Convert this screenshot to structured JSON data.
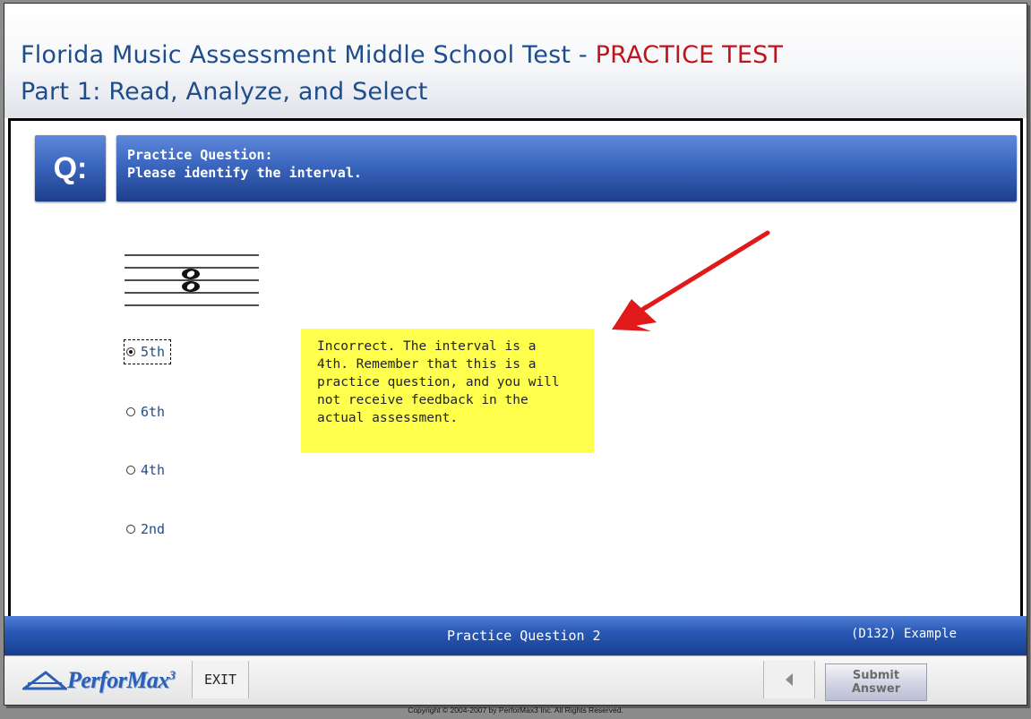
{
  "header": {
    "title_part1": "Florida Music Assessment Middle School Test - ",
    "title_highlight": "PRACTICE TEST",
    "subtitle": "Part 1: Read, Analyze, and Select"
  },
  "question": {
    "label": "Q:",
    "heading": "Practice Question:",
    "prompt": "Please identify the interval."
  },
  "options": [
    {
      "label": "5th",
      "selected": true
    },
    {
      "label": "6th",
      "selected": false
    },
    {
      "label": "4th",
      "selected": false
    },
    {
      "label": "2nd",
      "selected": false
    }
  ],
  "feedback": {
    "lines": [
      "Incorrect. The interval is a",
      "4th. Remember that this is a",
      "practice question, and you will",
      "not receive feedback in the",
      "actual assessment."
    ]
  },
  "footer": {
    "question_number": "Practice Question 2",
    "reference": "(D132) Example"
  },
  "toolbar": {
    "logo": "PerforMax",
    "logo_sup": "3",
    "exit_label": "EXIT",
    "submit_line1": "Submit",
    "submit_line2": "Answer"
  },
  "copyright": "Copyright © 2004-2007 by PerforMax3 Inc.  All Rights Reserved.",
  "colors": {
    "title_blue": "#1f4d8c",
    "title_red": "#c0141c",
    "bar_blue": "#2a59b5",
    "feedback_yellow": "#ffff4d",
    "arrow_red": "#e01a1a"
  },
  "icons": {
    "prev": "left-triangle-icon",
    "radio": "radio-button-icon",
    "staff": "music-staff-interval-icon"
  }
}
